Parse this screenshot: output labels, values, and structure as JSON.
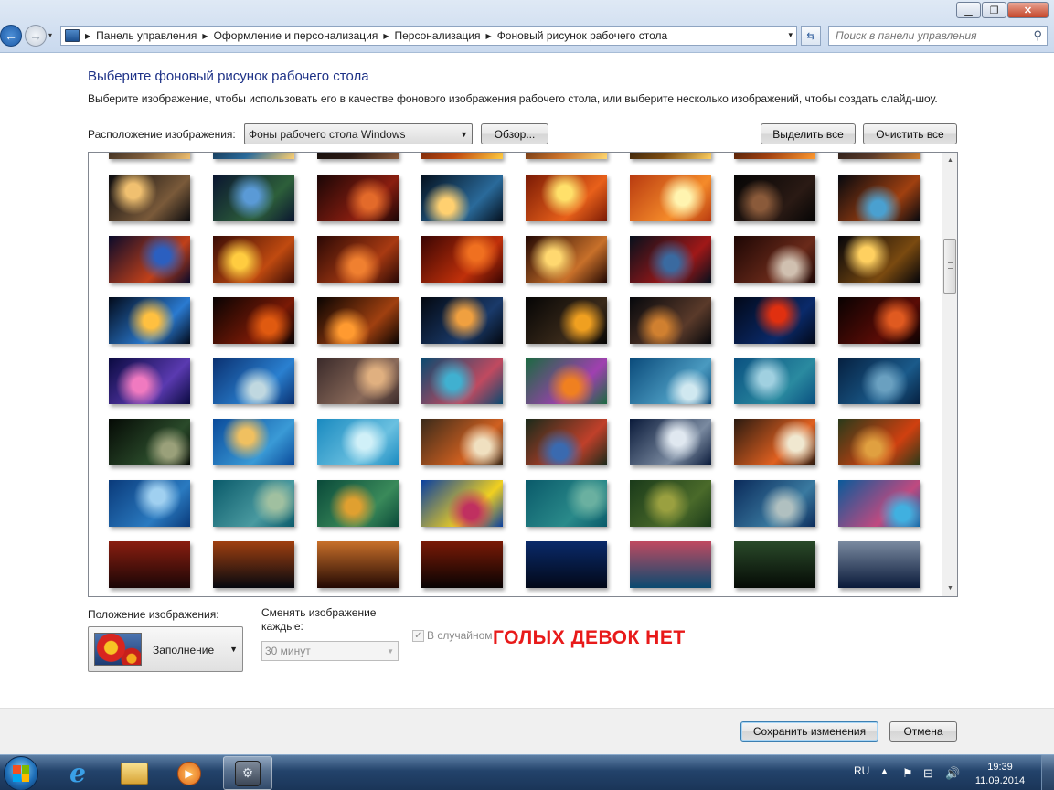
{
  "window": {
    "minimize_label": "▁",
    "maximize_label": "❐",
    "close_label": "✕"
  },
  "nav": {
    "back_icon": "←",
    "forward_icon": "→",
    "dropdown_icon": "▾"
  },
  "breadcrumb": {
    "items": [
      "Панель управления",
      "Оформление и персонализация",
      "Персонализация",
      "Фоновый рисунок рабочего стола"
    ],
    "separator": "▶"
  },
  "search": {
    "placeholder": "Поиск в панели управления"
  },
  "page": {
    "title": "Выберите фоновый рисунок рабочего стола",
    "description": "Выберите изображение, чтобы использовать его в качестве фонового изображения рабочего стола, или выберите несколько изображений, чтобы создать слайд-шоу."
  },
  "location": {
    "label": "Расположение изображения:",
    "selected": "Фоны рабочего стола Windows",
    "browse_label": "Обзор...",
    "select_all_label": "Выделить все",
    "clear_all_label": "Очистить все"
  },
  "gallery": {
    "thumbnails": [
      {
        "c1": "#0b0b0e",
        "c2": "#7a5a3a",
        "c3": "#f0c070"
      },
      {
        "c1": "#0a1530",
        "c2": "#2d5f3a",
        "c3": "#5a9ad6"
      },
      {
        "c1": "#1a0606",
        "c2": "#8a1e10",
        "c3": "#e36a2a"
      },
      {
        "c1": "#04101e",
        "c2": "#2a6a9a",
        "c3": "#ffd070"
      },
      {
        "c1": "#7a1a05",
        "c2": "#e8601a",
        "c3": "#ffe06a"
      },
      {
        "c1": "#b83a10",
        "c2": "#f58b2a",
        "c3": "#fff4b0"
      },
      {
        "c1": "#050505",
        "c2": "#2a1a14",
        "c3": "#8a5a3a"
      },
      {
        "c1": "#05080f",
        "c2": "#a04010",
        "c3": "#4aa0d0"
      },
      {
        "c1": "#0a0a2a",
        "c2": "#c0401a",
        "c3": "#2b5fc0"
      },
      {
        "c1": "#3a0c06",
        "c2": "#c04a10",
        "c3": "#ffcc40"
      },
      {
        "c1": "#2a0805",
        "c2": "#a83a12",
        "c3": "#f08030"
      },
      {
        "c1": "#3a0503",
        "c2": "#c0300a",
        "c3": "#f07020"
      },
      {
        "c1": "#220803",
        "c2": "#c8702a",
        "c3": "#ffd870"
      },
      {
        "c1": "#06101c",
        "c2": "#a01818",
        "c3": "#3a6aa0"
      },
      {
        "c1": "#1c0604",
        "c2": "#6a2a1a",
        "c3": "#d0c0b0"
      },
      {
        "c1": "#05050a",
        "c2": "#7a4a10",
        "c3": "#ffd060"
      },
      {
        "c1": "#020a1a",
        "c2": "#2a7ad0",
        "c3": "#ffc040"
      },
      {
        "c1": "#080303",
        "c2": "#7a1a06",
        "c3": "#e05a10"
      },
      {
        "c1": "#0a0402",
        "c2": "#a04010",
        "c3": "#ff9a30"
      },
      {
        "c1": "#030810",
        "c2": "#1a3a6a",
        "c3": "#f0a040"
      },
      {
        "c1": "#050505",
        "c2": "#3a2a1a",
        "c3": "#f0a020"
      },
      {
        "c1": "#06080c",
        "c2": "#5a3a2a",
        "c3": "#d08030"
      },
      {
        "c1": "#020818",
        "c2": "#0a2a6a",
        "c3": "#e03010"
      },
      {
        "c1": "#090202",
        "c2": "#5a0c06",
        "c3": "#e05a20"
      },
      {
        "c1": "#0a0a40",
        "c2": "#5a3ab0",
        "c3": "#f07ac0"
      },
      {
        "c1": "#0a3070",
        "c2": "#2a80d0",
        "c3": "#c0d8e0"
      },
      {
        "c1": "#3a2a2a",
        "c2": "#8a6a5a",
        "c3": "#e0b080"
      },
      {
        "c1": "#0a4a70",
        "c2": "#c04a60",
        "c3": "#40b0d0"
      },
      {
        "c1": "#1a6a40",
        "c2": "#a040b0",
        "c3": "#f08020"
      },
      {
        "c1": "#0a4a7a",
        "c2": "#4a9ac0",
        "c3": "#d0e8f0"
      },
      {
        "c1": "#0a5080",
        "c2": "#2a8aa0",
        "c3": "#a0d0e0"
      },
      {
        "c1": "#062040",
        "c2": "#1a5a8a",
        "c3": "#6aa0c0"
      },
      {
        "c1": "#050a05",
        "c2": "#2a4a2a",
        "c3": "#9aa07a"
      },
      {
        "c1": "#0a4a9a",
        "c2": "#3a9ad6",
        "c3": "#f0c060"
      },
      {
        "c1": "#1a8ac0",
        "c2": "#6ac0e0",
        "c3": "#d0f0f8"
      },
      {
        "c1": "#3a2a1a",
        "c2": "#d06020",
        "c3": "#f0e0c0"
      },
      {
        "c1": "#1a2a1a",
        "c2": "#c0402a",
        "c3": "#3a6ab0"
      },
      {
        "c1": "#0a1a3a",
        "c2": "#7a8aa0",
        "c3": "#e0e8f0"
      },
      {
        "c1": "#2a1a10",
        "c2": "#e06020",
        "c3": "#f0e8d0"
      },
      {
        "c1": "#2a3a1a",
        "c2": "#d04010",
        "c3": "#e0a040"
      },
      {
        "c1": "#0a3a7a",
        "c2": "#2a7ac0",
        "c3": "#a0d0f0"
      },
      {
        "c1": "#0a5a6a",
        "c2": "#4a9aa0",
        "c3": "#a0c0a0"
      },
      {
        "c1": "#0a4a3a",
        "c2": "#3a8a5a",
        "c3": "#e0a030"
      },
      {
        "c1": "#0a40a0",
        "c2": "#f0d020",
        "c3": "#c03060"
      },
      {
        "c1": "#0a5a6a",
        "c2": "#2a8a8a",
        "c3": "#6ab0a0"
      },
      {
        "c1": "#1a3a1a",
        "c2": "#4a6a2a",
        "c3": "#9aa040"
      },
      {
        "c1": "#0a2a5a",
        "c2": "#3a7aa0",
        "c3": "#b0c0c0"
      },
      {
        "c1": "#0a5a9a",
        "c2": "#c04a80",
        "c3": "#40b0e0"
      }
    ]
  },
  "position": {
    "label": "Положение изображения:",
    "selected": "Заполнение"
  },
  "slideshow": {
    "change_label": "Сменять изображение каждые:",
    "interval": "30 минут",
    "random_label": "В случайном порядке",
    "random_checked": "✓"
  },
  "overlay": {
    "text": "ГОЛЫХ ДЕВОК НЕТ"
  },
  "footer": {
    "save_label": "Сохранить изменения",
    "cancel_label": "Отмена"
  },
  "taskbar": {
    "ie_glyph": "e",
    "media_glyph": "▶",
    "cp_glyph": "⚙",
    "lang": "RU",
    "tray_arrow": "▲",
    "time": "19:39",
    "date": "11.09.2014"
  }
}
